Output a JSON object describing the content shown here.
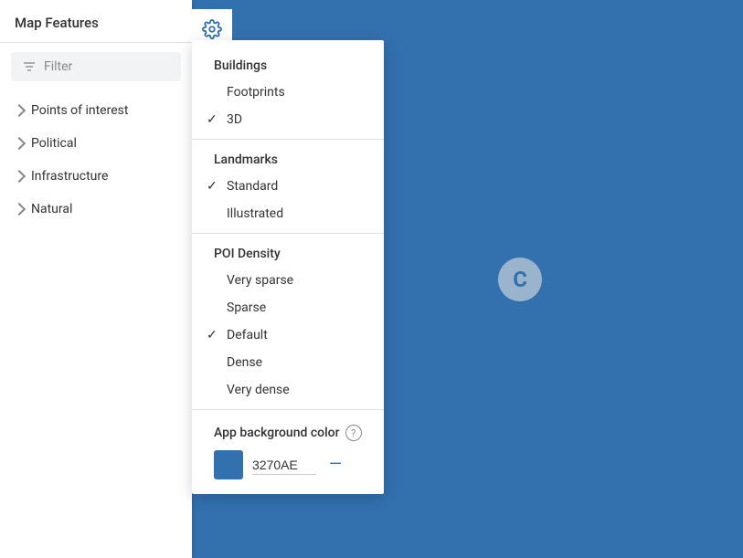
{
  "sidebar": {
    "title": "Map Features",
    "filter_placeholder": "Filter",
    "items": [
      {
        "id": "points-of-interest",
        "label": "Points of interest"
      },
      {
        "id": "political",
        "label": "Political"
      },
      {
        "id": "infrastructure",
        "label": "Infrastructure"
      },
      {
        "id": "natural",
        "label": "Natural"
      }
    ]
  },
  "dropdown": {
    "sections": [
      {
        "id": "buildings",
        "title": "Buildings",
        "items": [
          {
            "id": "footprints",
            "label": "Footprints",
            "checked": false
          },
          {
            "id": "3d",
            "label": "3D",
            "checked": true
          }
        ]
      },
      {
        "id": "landmarks",
        "title": "Landmarks",
        "items": [
          {
            "id": "standard",
            "label": "Standard",
            "checked": true
          },
          {
            "id": "illustrated",
            "label": "Illustrated",
            "checked": false
          }
        ]
      },
      {
        "id": "poi-density",
        "title": "POI Density",
        "items": [
          {
            "id": "very-sparse",
            "label": "Very sparse",
            "checked": false
          },
          {
            "id": "sparse",
            "label": "Sparse",
            "checked": false
          },
          {
            "id": "default",
            "label": "Default",
            "checked": true
          },
          {
            "id": "dense",
            "label": "Dense",
            "checked": false
          },
          {
            "id": "very-dense",
            "label": "Very dense",
            "checked": false
          }
        ]
      }
    ],
    "app_bg": {
      "title": "App background color",
      "help_tooltip": "?",
      "color_value": "3270AE",
      "color_hex": "#3270ae"
    }
  },
  "icons": {
    "filter": "≡",
    "check": "✓",
    "clear": "—"
  }
}
